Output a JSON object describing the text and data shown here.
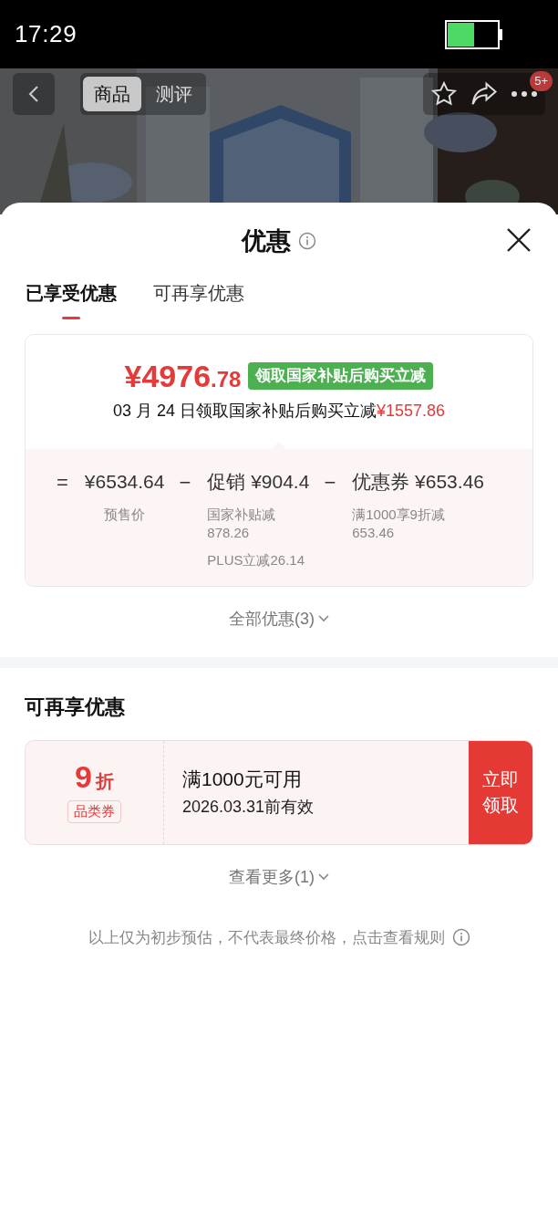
{
  "status_bar": {
    "time": "17:29"
  },
  "nav": {
    "tabs": [
      {
        "label": "商品",
        "selected": true
      },
      {
        "label": "测评",
        "selected": false
      }
    ],
    "badge": "5+"
  },
  "sheet": {
    "title": "优惠",
    "tabs": [
      {
        "label": "已享受优惠",
        "selected": true
      },
      {
        "label": "可再享优惠",
        "selected": false
      }
    ],
    "summary": {
      "price": "¥4976",
      "price_cents": ".78",
      "tag": "领取国家补贴后购买立减",
      "note": "03 月 24 日领取国家补贴后购买立减",
      "note_amount": "¥1557.86"
    },
    "breakdown": [
      {
        "operator": "=",
        "amount": "¥6534.64",
        "details": [
          "预售价"
        ]
      },
      {
        "operator": "−",
        "amount": "促销 ¥904.4",
        "details": [
          "国家补贴减\n878.26",
          "PLUS立减26.14"
        ]
      },
      {
        "operator": "−",
        "amount": "优惠券 ¥653.46",
        "details": [
          "满1000享9折减\n653.46"
        ]
      }
    ],
    "all_link": "全部优惠(3)"
  },
  "more_section": {
    "title": "可再享优惠",
    "coupons": [
      {
        "value": "9",
        "unit": "折",
        "type": "品类券",
        "condition": "满1000元可用",
        "validity": "2026.03.31前有效",
        "action": "立即领取"
      }
    ],
    "more_link": "查看更多(1)"
  },
  "disclaimer": "以上仅为初步预估，不代表最终价格，点击查看规则"
}
